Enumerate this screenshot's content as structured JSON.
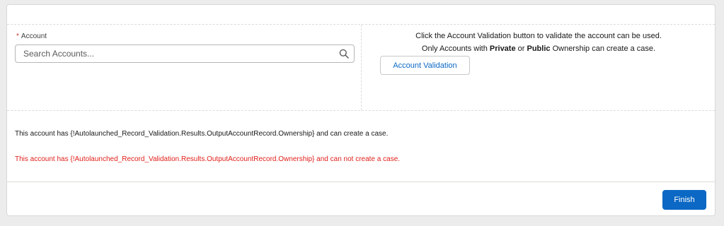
{
  "account_field": {
    "required_marker": "*",
    "label": "Account",
    "value": "",
    "placeholder": "Search Accounts...",
    "icon": "search-icon"
  },
  "info": {
    "line1": "Click the Account Validation button to validate the account can be used.",
    "line2_prefix": "Only Accounts with ",
    "line2_private": "Private",
    "line2_or": " or ",
    "line2_public": "Public",
    "line2_suffix": " Ownership can create a case."
  },
  "validate_button_label": "Account Validation",
  "messages": {
    "can_create": "This account has {!Autolaunched_Record_Validation.Results.OutputAccountRecord.Ownership} and can create a case.",
    "cannot_create": "This account has {!Autolaunched_Record_Validation.Results.OutputAccountRecord.Ownership} and can not create a case."
  },
  "finish_button_label": "Finish",
  "colors": {
    "brand": "#0b68c4",
    "error": "#e0211c",
    "required": "#c23934",
    "background": "#ececec"
  }
}
